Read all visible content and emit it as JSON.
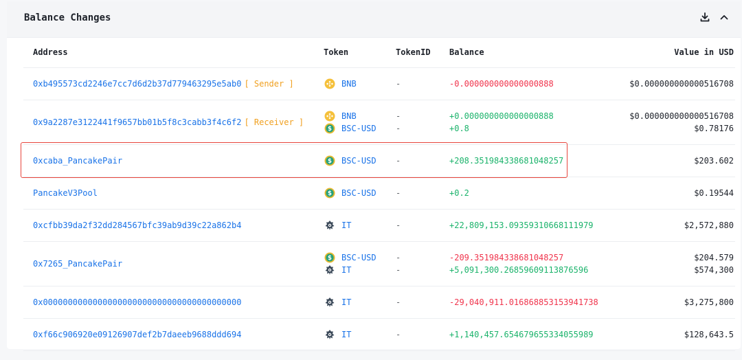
{
  "panel": {
    "title": "Balance Changes",
    "download_icon": "download-icon",
    "collapse_icon": "chevron-up-icon"
  },
  "table": {
    "headers": [
      "Address",
      "Token",
      "TokenID",
      "Balance",
      "Value in USD"
    ],
    "rows": [
      {
        "address": "0xb495573cd2246e7cc7d6d2b37d779463295e5ab0",
        "tag": "[ Sender ]",
        "tokens": [
          {
            "icon": "bnb-icon",
            "symbol": "BNB",
            "id": "-",
            "balance": "-0.000000000000000888",
            "sign": "neg",
            "usd": "$0.000000000000516708"
          }
        ]
      },
      {
        "address": "0x9a2287e3122441f9657bb01b5f8c3cabb3f4c6f2",
        "tag": "[ Receiver ]",
        "tokens": [
          {
            "icon": "bnb-icon",
            "symbol": "BNB",
            "id": "-",
            "balance": "+0.000000000000000888",
            "sign": "pos",
            "usd": "$0.000000000000516708"
          },
          {
            "icon": "bsc-usd-icon",
            "symbol": "BSC-USD",
            "id": "-",
            "balance": "+0.8",
            "sign": "pos",
            "usd": "$0.78176"
          }
        ]
      },
      {
        "address": "0xcaba_PancakePair",
        "tag": "",
        "tokens": [
          {
            "icon": "bsc-usd-icon",
            "symbol": "BSC-USD",
            "id": "-",
            "balance": "+208.351984338681048257",
            "sign": "pos",
            "usd": "$203.602"
          }
        ]
      },
      {
        "address": "PancakeV3Pool",
        "tag": "",
        "tokens": [
          {
            "icon": "bsc-usd-icon",
            "symbol": "BSC-USD",
            "id": "-",
            "balance": "+0.2",
            "sign": "pos",
            "usd": "$0.19544"
          }
        ]
      },
      {
        "address": "0xcfbb39da2f32dd284567bfc39ab9d39c22a862b4",
        "tag": "",
        "tokens": [
          {
            "icon": "it-token-icon",
            "symbol": "IT",
            "id": "-",
            "balance": "+22,809,153.09359310668111979",
            "sign": "pos",
            "usd": "$2,572,880"
          }
        ]
      },
      {
        "address": "0x7265_PancakePair",
        "tag": "",
        "tokens": [
          {
            "icon": "bsc-usd-icon",
            "symbol": "BSC-USD",
            "id": "-",
            "balance": "-209.351984338681048257",
            "sign": "neg",
            "usd": "$204.579"
          },
          {
            "icon": "it-token-icon",
            "symbol": "IT",
            "id": "-",
            "balance": "+5,091,300.26859609113876596",
            "sign": "pos",
            "usd": "$574,300"
          }
        ]
      },
      {
        "address": "0x0000000000000000000000000000000000000000",
        "tag": "",
        "tokens": [
          {
            "icon": "it-token-icon",
            "symbol": "IT",
            "id": "-",
            "balance": "-29,040,911.016868853153941738",
            "sign": "neg",
            "usd": "$3,275,800"
          }
        ]
      },
      {
        "address": "0xf66c906920e09126907def2b7daeeb9688ddd694",
        "tag": "",
        "tokens": [
          {
            "icon": "it-token-icon",
            "symbol": "IT",
            "id": "-",
            "balance": "+1,140,457.654679655334055989",
            "sign": "pos",
            "usd": "$128,643.5"
          }
        ]
      }
    ]
  },
  "highlight": {
    "row": "0xcaba_PancakePair",
    "color": "#e8453c"
  },
  "colors": {
    "link": "#1a73e8",
    "positive": "#1bb36b",
    "negative": "#f0344c",
    "tag": "#f0a020"
  }
}
